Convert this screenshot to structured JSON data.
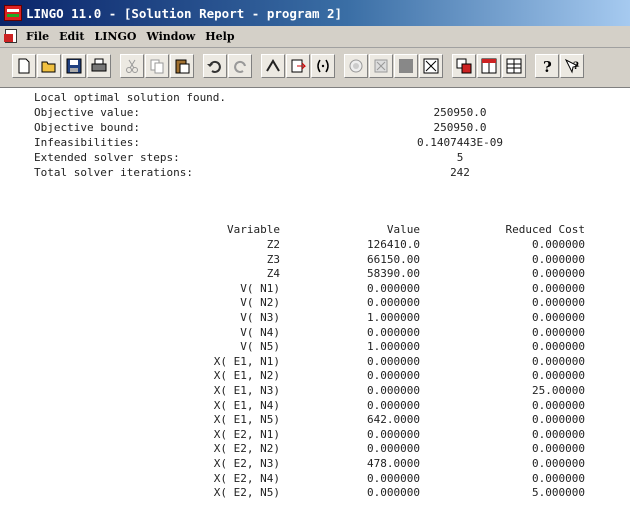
{
  "window": {
    "title": "LINGO 11.0 - [Solution Report - program 2]"
  },
  "menu": {
    "items": [
      "File",
      "Edit",
      "LINGO",
      "Window",
      "Help"
    ]
  },
  "toolbar": {
    "buttons": [
      "new-icon",
      "open-icon",
      "save-icon",
      "print-icon",
      "cut-icon",
      "copy-icon",
      "paste-icon",
      "undo-icon",
      "redo-icon",
      "find-icon",
      "goto-icon",
      "match-paren-icon",
      "solve-icon",
      "close-all-icon",
      "stop-icon",
      "toggle-icon",
      "window-icon",
      "tile-icon",
      "cascade-icon",
      "help-icon",
      "context-help-icon"
    ]
  },
  "report": {
    "header": "Local optimal solution found.",
    "summary": [
      {
        "label": "Objective value:",
        "value": "250950.0"
      },
      {
        "label": "Objective bound:",
        "value": "250950.0"
      },
      {
        "label": "Infeasibilities:",
        "value": "0.1407443E-09"
      },
      {
        "label": "Extended solver steps:",
        "value": "5"
      },
      {
        "label": "Total solver iterations:",
        "value": "242"
      }
    ],
    "columns": {
      "variable": "Variable",
      "value": "Value",
      "reduced_cost": "Reduced Cost"
    },
    "rows": [
      {
        "variable": "Z2",
        "value": "126410.0",
        "reduced_cost": "0.000000"
      },
      {
        "variable": "Z3",
        "value": "66150.00",
        "reduced_cost": "0.000000"
      },
      {
        "variable": "Z4",
        "value": "58390.00",
        "reduced_cost": "0.000000"
      },
      {
        "variable": "V( N1)",
        "value": "0.000000",
        "reduced_cost": "0.000000"
      },
      {
        "variable": "V( N2)",
        "value": "0.000000",
        "reduced_cost": "0.000000"
      },
      {
        "variable": "V( N3)",
        "value": "1.000000",
        "reduced_cost": "0.000000"
      },
      {
        "variable": "V( N4)",
        "value": "0.000000",
        "reduced_cost": "0.000000"
      },
      {
        "variable": "V( N5)",
        "value": "1.000000",
        "reduced_cost": "0.000000"
      },
      {
        "variable": "X( E1, N1)",
        "value": "0.000000",
        "reduced_cost": "0.000000"
      },
      {
        "variable": "X( E1, N2)",
        "value": "0.000000",
        "reduced_cost": "0.000000"
      },
      {
        "variable": "X( E1, N3)",
        "value": "0.000000",
        "reduced_cost": "25.00000"
      },
      {
        "variable": "X( E1, N4)",
        "value": "0.000000",
        "reduced_cost": "0.000000"
      },
      {
        "variable": "X( E1, N5)",
        "value": "642.0000",
        "reduced_cost": "0.000000"
      },
      {
        "variable": "X( E2, N1)",
        "value": "0.000000",
        "reduced_cost": "0.000000"
      },
      {
        "variable": "X( E2, N2)",
        "value": "0.000000",
        "reduced_cost": "0.000000"
      },
      {
        "variable": "X( E2, N3)",
        "value": "478.0000",
        "reduced_cost": "0.000000"
      },
      {
        "variable": "X( E2, N4)",
        "value": "0.000000",
        "reduced_cost": "0.000000"
      },
      {
        "variable": "X( E2, N5)",
        "value": "0.000000",
        "reduced_cost": "5.000000"
      }
    ]
  }
}
